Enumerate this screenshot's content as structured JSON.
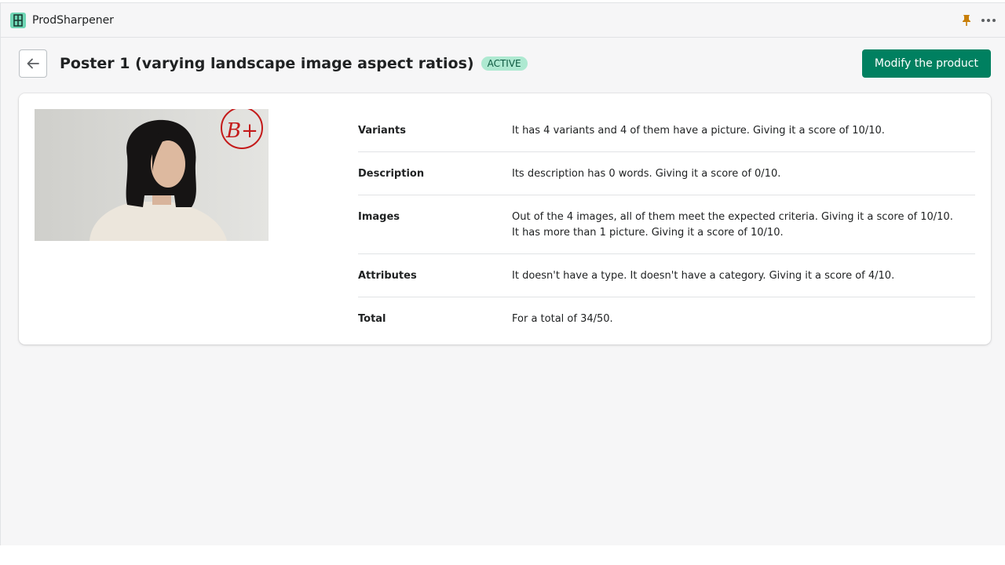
{
  "app": {
    "name": "ProdSharpener",
    "accent_color": "#008060"
  },
  "topbar": {
    "pin_icon": "pin-icon",
    "more_icon": "more-horizontal-icon"
  },
  "header": {
    "back_icon": "arrow-left-icon",
    "title": "Poster 1 (varying landscape image aspect ratios)",
    "status_badge": "ACTIVE",
    "primary_button": "Modify the product"
  },
  "product": {
    "grade": "B+"
  },
  "scores": [
    {
      "label": "Variants",
      "lines": [
        "It has 4 variants and 4 of them have a picture. Giving it a score of 10/10."
      ]
    },
    {
      "label": "Description",
      "lines": [
        "Its description has 0 words. Giving it a score of 0/10."
      ]
    },
    {
      "label": "Images",
      "lines": [
        "Out of the 4 images, all of them meet the expected criteria. Giving it a score of 10/10.",
        "It has more than 1 picture. Giving it a score of 10/10."
      ]
    },
    {
      "label": "Attributes",
      "lines": [
        "It doesn't have a type. It doesn't have a category. Giving it a score of 4/10."
      ]
    },
    {
      "label": "Total",
      "lines": [
        "For a total of 34/50."
      ]
    }
  ]
}
